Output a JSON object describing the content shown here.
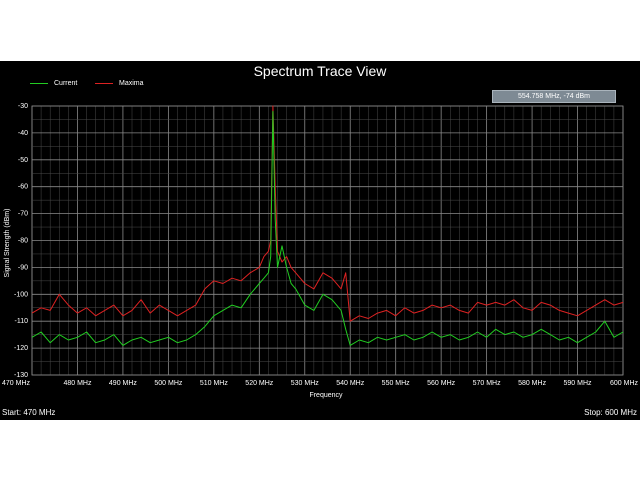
{
  "window": {
    "title": "Spectrum Trace View",
    "readout": "554.758 MHz,   -74 dBm",
    "status_start": "Start: 470 MHz",
    "status_stop": "Stop: 600 MHz"
  },
  "colors": {
    "current": "#22cc22",
    "maxima": "#dd2222",
    "grid": "#8a8a8a",
    "background": "#000000"
  },
  "chart_data": {
    "type": "line",
    "title": "Spectrum Trace View",
    "xlabel": "Frequency",
    "ylabel": "Signal Strength (dBm)",
    "xlim": [
      470,
      600
    ],
    "ylim": [
      -130,
      -30
    ],
    "xticks": [
      470,
      480,
      490,
      500,
      510,
      520,
      530,
      540,
      550,
      560,
      570,
      580,
      590,
      600
    ],
    "xtick_labels": [
      "470 MHz",
      "480 MHz",
      "490 MHz",
      "500 MHz",
      "510 MHz",
      "520 MHz",
      "530 MHz",
      "540 MHz",
      "550 MHz",
      "560 MHz",
      "570 MHz",
      "580 MHz",
      "590 MHz",
      "600 MHz"
    ],
    "yticks": [
      -30,
      -40,
      -50,
      -60,
      -70,
      -80,
      -90,
      -100,
      -110,
      -120,
      -130
    ],
    "ytick_labels": [
      "-30",
      "-40",
      "-50",
      "-60",
      "-70",
      "-80",
      "-90",
      "-100",
      "-110",
      "-120",
      "-130"
    ],
    "grid": true,
    "legend": "top-left",
    "x": [
      470,
      472,
      474,
      476,
      478,
      480,
      482,
      484,
      486,
      488,
      490,
      492,
      494,
      496,
      498,
      500,
      502,
      504,
      506,
      508,
      510,
      512,
      514,
      516,
      518,
      520,
      521,
      522,
      522.5,
      523,
      523.5,
      524,
      525,
      526,
      527,
      528,
      530,
      532,
      534,
      536,
      538,
      539,
      540,
      542,
      544,
      546,
      548,
      550,
      552,
      554,
      556,
      558,
      560,
      562,
      564,
      566,
      568,
      570,
      572,
      574,
      576,
      578,
      580,
      582,
      584,
      586,
      588,
      590,
      592,
      594,
      596,
      598,
      600
    ],
    "series": [
      {
        "name": "Current",
        "values": [
          -116,
          -114,
          -118,
          -115,
          -117,
          -116,
          -114,
          -118,
          -117,
          -115,
          -119,
          -117,
          -116,
          -118,
          -117,
          -116,
          -118,
          -117,
          -115,
          -112,
          -108,
          -106,
          -104,
          -105,
          -100,
          -96,
          -94,
          -92,
          -86,
          -32,
          -72,
          -90,
          -82,
          -90,
          -96,
          -98,
          -104,
          -106,
          -100,
          -102,
          -106,
          -113,
          -119,
          -117,
          -118,
          -116,
          -117,
          -116,
          -115,
          -117,
          -116,
          -114,
          -116,
          -115,
          -117,
          -116,
          -114,
          -116,
          -113,
          -115,
          -114,
          -116,
          -115,
          -113,
          -115,
          -117,
          -116,
          -118,
          -116,
          -114,
          -110,
          -116,
          -114
        ]
      },
      {
        "name": "Maxima",
        "values": [
          -107,
          -105,
          -106,
          -100,
          -104,
          -107,
          -105,
          -108,
          -106,
          -104,
          -108,
          -106,
          -102,
          -107,
          -104,
          -106,
          -108,
          -106,
          -104,
          -98,
          -95,
          -96,
          -94,
          -95,
          -92,
          -90,
          -86,
          -84,
          -80,
          -30,
          -60,
          -84,
          -88,
          -86,
          -90,
          -92,
          -96,
          -98,
          -92,
          -94,
          -98,
          -92,
          -110,
          -108,
          -109,
          -107,
          -106,
          -108,
          -105,
          -107,
          -106,
          -104,
          -105,
          -104,
          -106,
          -107,
          -103,
          -104,
          -103,
          -104,
          -102,
          -105,
          -106,
          -103,
          -104,
          -106,
          -107,
          -108,
          -106,
          -104,
          -102,
          -104,
          -103
        ]
      }
    ]
  }
}
